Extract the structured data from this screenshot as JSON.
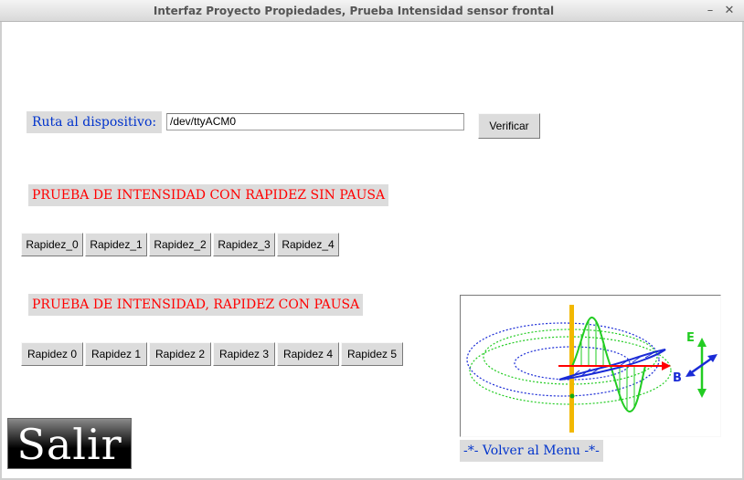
{
  "window": {
    "title": "Interfaz Proyecto Propiedades, Prueba Intensidad sensor frontal",
    "minimize_glyph": "–",
    "close_glyph": "✕"
  },
  "device": {
    "label": "Ruta al dispositivo:",
    "path_value": "/dev/ttyACM0",
    "verify_label": "Verificar"
  },
  "sin_pausa": {
    "title": "PRUEBA DE INTENSIDAD CON RAPIDEZ SIN PAUSA",
    "buttons": [
      "Rapidez_0",
      "Rapidez_1",
      "Rapidez_2",
      "Rapidez_3",
      "Rapidez_4"
    ]
  },
  "con_pausa": {
    "title": "PRUEBA DE INTENSIDAD,  RAPIDEZ CON PAUSA",
    "buttons": [
      "Rapidez 0",
      "Rapidez 1",
      "Rapidez 2",
      "Rapidez 3",
      "Rapidez 4",
      "Rapidez 5"
    ]
  },
  "exit_label": "Salir",
  "back_label": "-*- Volver al Menu -*-",
  "image": {
    "e_label": "E",
    "b_label": "B",
    "colors": {
      "e_field": "#22cc22",
      "b_field": "#1a2bd6",
      "axis": "#ff0000",
      "pole": "#f2b800"
    }
  }
}
